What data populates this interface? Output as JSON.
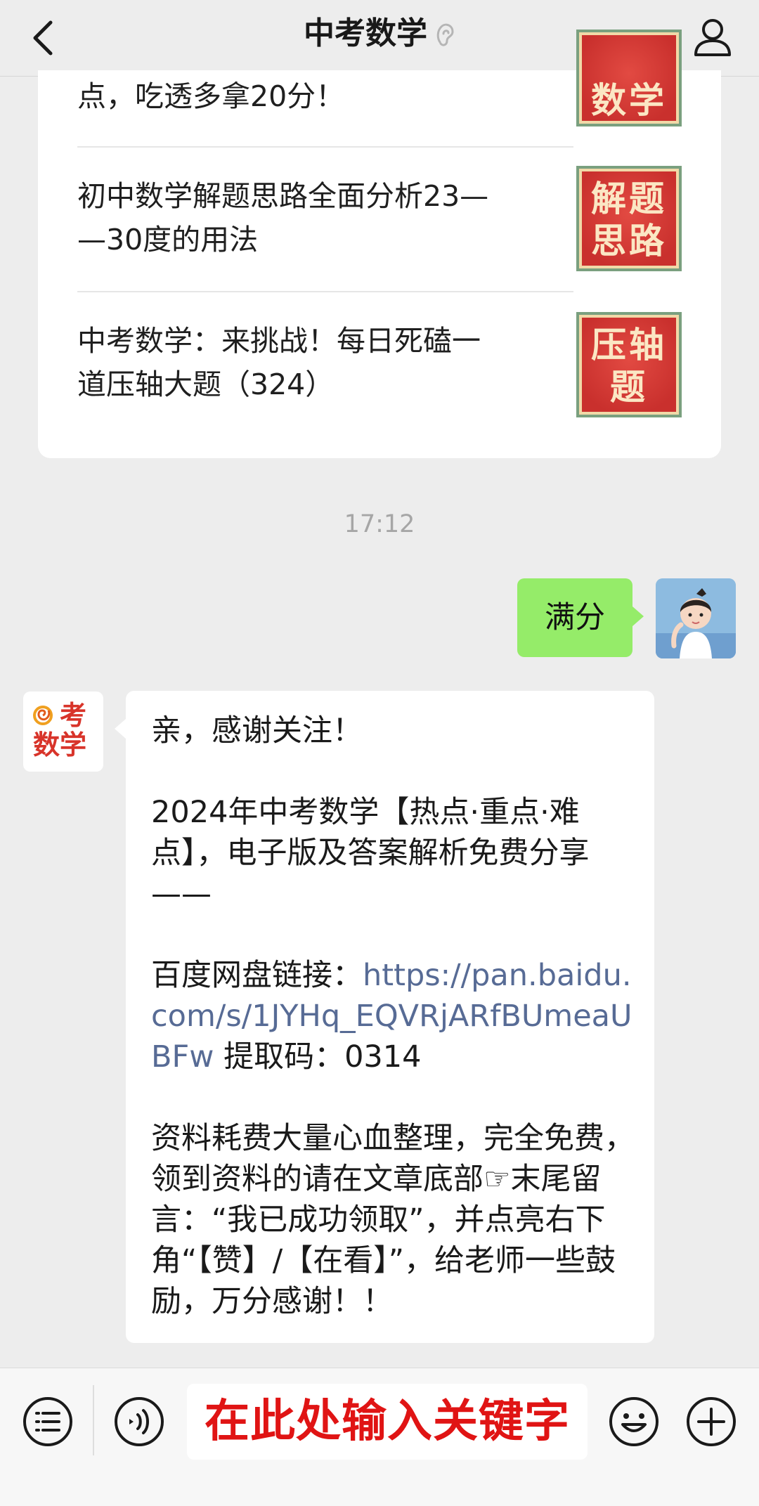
{
  "header": {
    "title": "中考数学",
    "back_icon": "chevron-left-icon",
    "ear_icon": "ear-icon",
    "profile_icon": "person-icon"
  },
  "articles": [
    {
      "title_lines": [
        "点，吃透多拿20分！"
      ],
      "thumb": [
        "数学"
      ]
    },
    {
      "title_lines": [
        "初中数学解题思路全面分析23—",
        "—30度的用法"
      ],
      "thumb": [
        "解题",
        "思路"
      ]
    },
    {
      "title_lines": [
        "中考数学：来挑战！每日死磕一",
        "道压轴大题（324）"
      ],
      "thumb": [
        "压轴",
        "题"
      ]
    }
  ],
  "chat": {
    "timestamp": "17:12",
    "outgoing": {
      "text": "满分"
    },
    "incoming": {
      "avatar_text": [
        "考",
        "数学"
      ],
      "greeting": "亲，感谢关注！",
      "share": "2024年中考数学【热点·重点·难点】，电子版及答案解析免费分享——",
      "link_prefix": "百度网盘链接：",
      "link": "https://pan.baidu.com/s/1JYHq_EQVRjARfBUmeaUBFw",
      "code": " 提取码：0314",
      "note": "资料耗费大量心血整理，完全免费，领到资料的请在文章底部☞末尾留言：“我已成功领取”，并点亮右下角“【赞】/【在看】”，给老师一些鼓励，万分感谢！！"
    }
  },
  "input_bar": {
    "menu_icon": "menu-list-icon",
    "voice_icon": "voice-icon",
    "input_text": "在此处输入关键字",
    "emoji_icon": "emoji-icon",
    "plus_icon": "plus-icon"
  },
  "colors": {
    "background": "#ededed",
    "outgoing_bubble": "#95ec69",
    "link": "#576b95",
    "input_text": "#e01414",
    "thumb_red": "#c9302d"
  }
}
